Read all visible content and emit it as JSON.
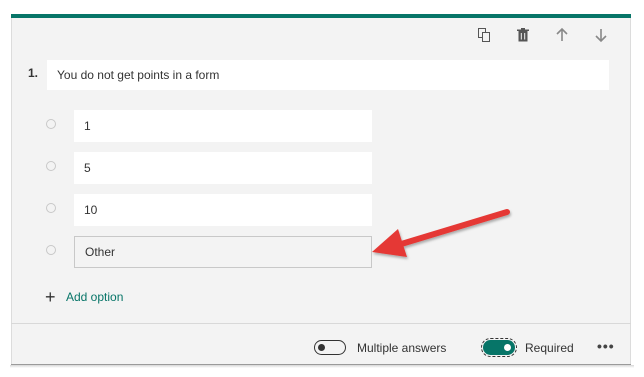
{
  "question": {
    "number": "1.",
    "text": "You do not get points in a form"
  },
  "toolbar": {
    "icons": [
      "copy-icon",
      "trash-icon",
      "arrow-up-icon",
      "arrow-down-icon"
    ]
  },
  "options": [
    {
      "label": "1"
    },
    {
      "label": "5"
    },
    {
      "label": "10"
    },
    {
      "label": "Other"
    }
  ],
  "add_option": {
    "icon": "plus-icon",
    "label": "Add option"
  },
  "footer": {
    "multiple_answers": {
      "label": "Multiple answers",
      "on": false
    },
    "required": {
      "label": "Required",
      "on": true
    },
    "more_icon": "more-icon"
  },
  "colors": {
    "accent": "#077568",
    "annotation_arrow": "#e53935",
    "card_background": "#f3f3f3"
  }
}
